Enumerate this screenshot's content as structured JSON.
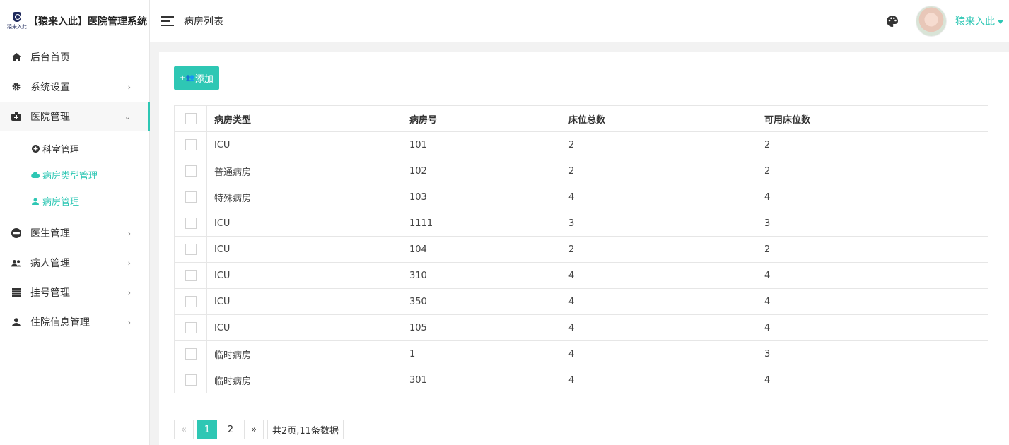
{
  "brand": {
    "logo_caption": "猿来入此",
    "title": "【猿来入此】医院管理系统"
  },
  "header": {
    "page_title": "病房列表",
    "username": "猿来入此"
  },
  "sidebar": {
    "items": [
      {
        "label": "后台首页",
        "icon": "home-icon"
      },
      {
        "label": "系统设置",
        "icon": "gear-icon"
      },
      {
        "label": "医院管理",
        "icon": "hospital-icon"
      },
      {
        "label": "医生管理",
        "icon": "doctor-icon"
      },
      {
        "label": "病人管理",
        "icon": "users-icon"
      },
      {
        "label": "挂号管理",
        "icon": "list-icon"
      },
      {
        "label": "住院信息管理",
        "icon": "user-icon"
      }
    ],
    "submenu": [
      {
        "label": "科室管理",
        "icon": "plus-circle-icon"
      },
      {
        "label": "病房类型管理",
        "icon": "cloud-icon"
      },
      {
        "label": "病房管理",
        "icon": "user-icon"
      }
    ]
  },
  "toolbar": {
    "add_label": "添加"
  },
  "table": {
    "columns": [
      "病房类型",
      "病房号",
      "床位总数",
      "可用床位数"
    ],
    "rows": [
      [
        "ICU",
        "101",
        "2",
        "2"
      ],
      [
        "普通病房",
        "102",
        "2",
        "2"
      ],
      [
        "特殊病房",
        "103",
        "4",
        "4"
      ],
      [
        "ICU",
        "1111",
        "3",
        "3"
      ],
      [
        "ICU",
        "104",
        "2",
        "2"
      ],
      [
        "ICU",
        "310",
        "4",
        "4"
      ],
      [
        "ICU",
        "350",
        "4",
        "4"
      ],
      [
        "ICU",
        "105",
        "4",
        "4"
      ],
      [
        "临时病房",
        "1",
        "4",
        "3"
      ],
      [
        "临时病房",
        "301",
        "4",
        "4"
      ]
    ]
  },
  "pagination": {
    "prev": "«",
    "pages": [
      "1",
      "2"
    ],
    "current": "1",
    "next": "»",
    "info": "共2页,11条数据"
  },
  "colors": {
    "accent": "#2ec7b4"
  }
}
